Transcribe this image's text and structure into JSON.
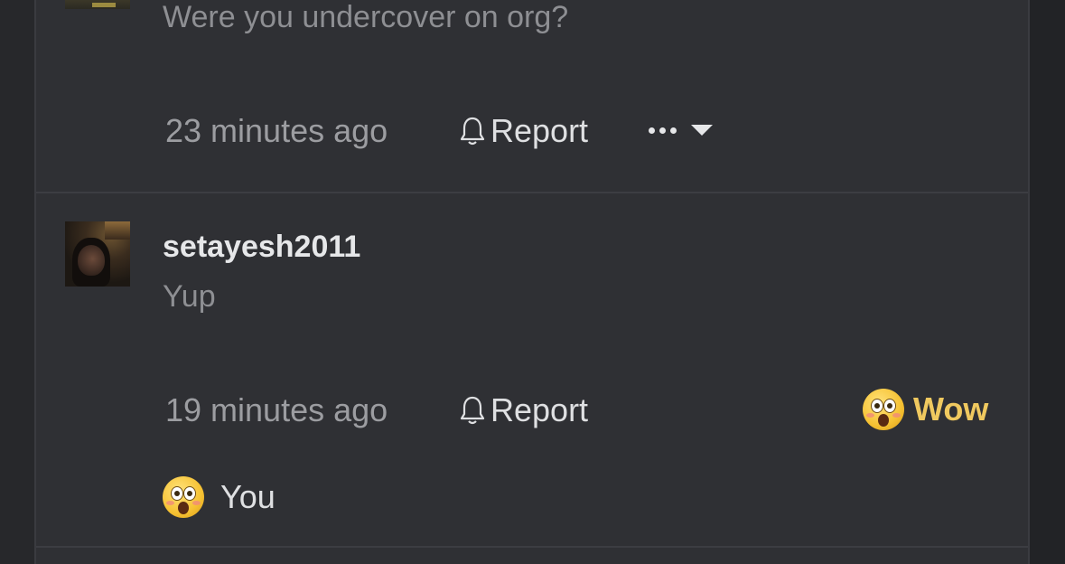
{
  "comments": [
    {
      "message": "Were you undercover on org?",
      "timestamp": "23 minutes ago",
      "report_label": "Report"
    },
    {
      "username": "setayesh2011",
      "message": "Yup",
      "timestamp": "19 minutes ago",
      "report_label": "Report",
      "reaction": {
        "icon": "astonished-face-emoji",
        "label": "Wow"
      },
      "reacted_by": {
        "icon": "astonished-face-emoji",
        "label": "You"
      }
    }
  ],
  "colors": {
    "background": "#2f3034",
    "reaction_accent": "#f0c95f",
    "muted_text": "#8e8f93"
  }
}
